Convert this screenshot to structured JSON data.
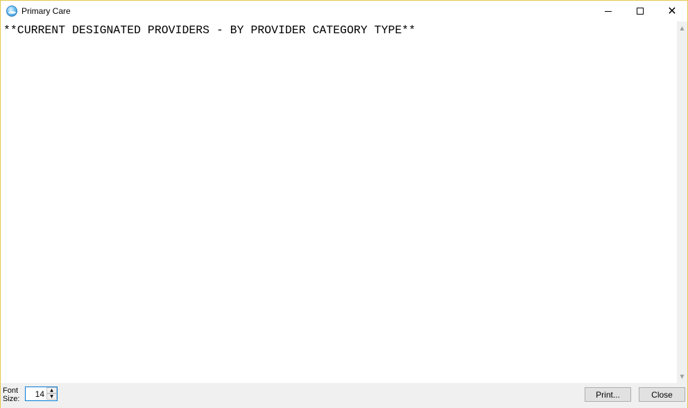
{
  "window": {
    "title": "Primary Care",
    "icon": "app-globe-icon"
  },
  "title_buttons": {
    "minimize_icon": "minimize-icon",
    "maximize_icon": "maximize-icon",
    "close_icon": "close-icon",
    "close_glyph": "✕"
  },
  "report": {
    "text": "**CURRENT DESIGNATED PROVIDERS - BY PROVIDER CATEGORY TYPE**"
  },
  "scrollbar": {
    "up_glyph": "▲",
    "down_glyph": "▼"
  },
  "footer": {
    "font_size_label": "Font Size:",
    "font_size_value": "14",
    "spin_up_glyph": "▲",
    "spin_down_glyph": "▼",
    "print_label": "Print...",
    "close_label": "Close"
  },
  "colors": {
    "window_border": "#e6c84a",
    "focus_border": "#0078d7",
    "panel_bg": "#f0f0f0"
  }
}
